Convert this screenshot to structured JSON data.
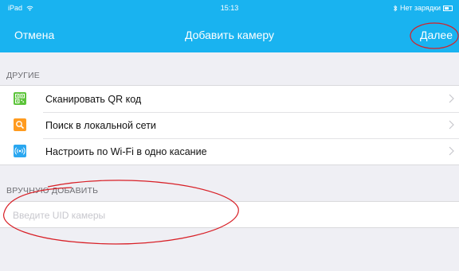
{
  "status_bar": {
    "device": "iPad",
    "time": "15:13",
    "battery_text": "Нет зарядки"
  },
  "nav": {
    "cancel_label": "Отмена",
    "title": "Добавить камеру",
    "next_label": "Далее"
  },
  "other_section": {
    "header": "ДРУГИЕ",
    "items": [
      {
        "label": "Сканировать QR код",
        "icon": "qr-code-icon",
        "color": "#5cc43a"
      },
      {
        "label": "Поиск в локальной сети",
        "icon": "search-icon",
        "color": "#ff9b1f"
      },
      {
        "label": "Настроить по Wi-Fi в одно касание",
        "icon": "wifi-broadcast-icon",
        "color": "#2aa7f0"
      }
    ]
  },
  "manual_section": {
    "header": "ВРУЧНУЮ ДОБАВИТЬ",
    "uid_placeholder": "Введите UID камеры",
    "uid_value": ""
  },
  "colors": {
    "accent": "#19b3f0",
    "background": "#efeff4",
    "annotation": "#d81f26"
  }
}
